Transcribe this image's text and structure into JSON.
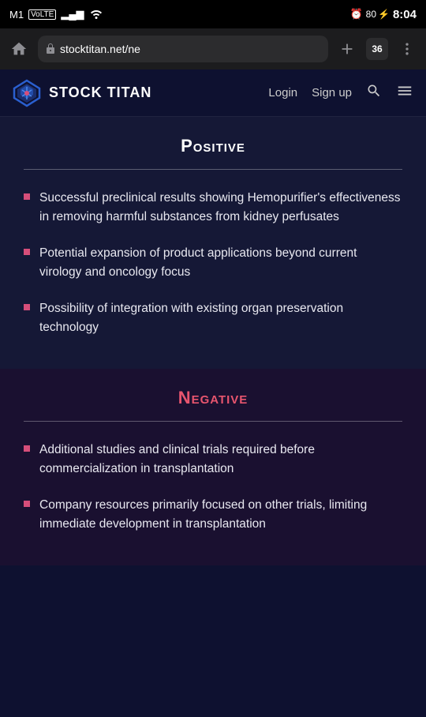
{
  "statusBar": {
    "carrier": "M1",
    "carrierType": "VoLTE",
    "signalBars": "▂▄▆",
    "wifi": "wifi",
    "time": "8:04",
    "alarmIcon": "⏰",
    "batteryLevel": "80",
    "chargingIcon": "⚡"
  },
  "browserChrome": {
    "url": "stocktitan.net/ne",
    "tabCount": "36"
  },
  "header": {
    "logoText": "STOCK TITAN",
    "loginLabel": "Login",
    "signupLabel": "Sign up"
  },
  "positiveSection": {
    "title": "Positive",
    "divider": true,
    "items": [
      "Successful preclinical results showing Hemopurifier's effectiveness in removing harmful substances from kidney perfusates",
      "Potential expansion of product applications beyond current virology and oncology focus",
      "Possibility of integration with existing organ preservation technology"
    ]
  },
  "negativeSection": {
    "title": "Negative",
    "divider": true,
    "items": [
      "Additional studies and clinical trials required before commercialization in transplantation",
      "Company resources primarily focused on other trials, limiting immediate development in transplantation"
    ]
  }
}
